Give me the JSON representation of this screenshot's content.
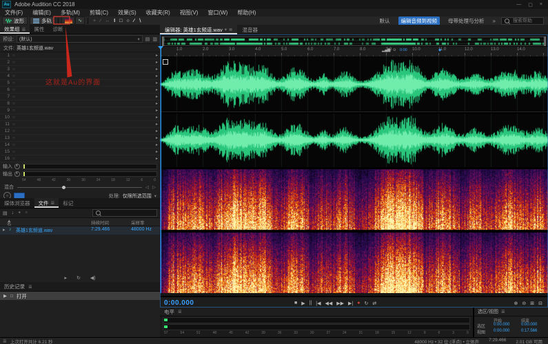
{
  "window": {
    "title": "Adobe Audition CC 2018",
    "app_badge": "Au",
    "minimize": "—",
    "maximize": "▢",
    "close": "×"
  },
  "menu": {
    "items": [
      "文件(F)",
      "编辑(E)",
      "多轨(M)",
      "剪辑(C)",
      "效果(S)",
      "收藏夹(R)",
      "视图(V)",
      "窗口(W)",
      "帮助(H)"
    ]
  },
  "toolbar": {
    "waveform_label": "波形",
    "multitrack_label": "多轨",
    "workspaces": [
      "默认",
      "编辑音频到视频",
      "母带处理与分析"
    ],
    "active_workspace": "编辑音频到视频",
    "overflow_glyph": "»",
    "search_placeholder": "搜索帮助"
  },
  "effects_rack": {
    "tabs": [
      "效果组",
      "属性",
      "诊断"
    ],
    "active_tab": "效果组",
    "preset_label": "预设:",
    "preset_value": "(默认)",
    "file_label": "文件:",
    "file_name": "英雄1玄频道.wav",
    "slot_numbers": [
      1,
      2,
      3,
      4,
      5,
      6,
      7,
      8,
      9,
      10,
      11,
      12,
      13,
      14,
      15,
      16
    ],
    "input_label": "输入",
    "output_label": "输出",
    "meter_scale": [
      54,
      48,
      42,
      36,
      30,
      24,
      18,
      12,
      6,
      0
    ],
    "mix_label": "混合",
    "process_label": "处理:",
    "process_value": "仅限所选范围"
  },
  "files_panel": {
    "tabs": [
      "媒体浏览器",
      "文件",
      "标记"
    ],
    "active_tab": "文件",
    "columns": [
      "名称",
      "持续时间",
      "采样率"
    ],
    "rows": [
      {
        "name": "英雄1玄频道.wav",
        "duration": "7:29.466",
        "sample_rate": "48000 Hz"
      }
    ]
  },
  "history_panel": {
    "title": "历史记录",
    "items": [
      {
        "label": "打开"
      }
    ]
  },
  "editor": {
    "tab_label": "编辑器: 英雄1玄频道.wav",
    "mixer_tab": "混音器",
    "ruler_ticks": [
      "1.0",
      "2.0",
      "3.0",
      "4.0",
      "5.0",
      "6.0",
      "7.0",
      "8.0",
      "9.0",
      "10.0",
      "11.0",
      "12.0",
      "13.0",
      "14.0"
    ],
    "hud_time": "0:00"
  },
  "annotation": {
    "text": "这就是Au的界面",
    "color": "#a8231a"
  },
  "transport": {
    "time": "0:00.000",
    "buttons": [
      {
        "name": "stop-button",
        "glyph": "■"
      },
      {
        "name": "play-button",
        "glyph": "▶"
      },
      {
        "name": "pause-button",
        "glyph": "||"
      },
      {
        "name": "skip-to-start-button",
        "glyph": "|◀"
      },
      {
        "name": "rewind-button",
        "glyph": "◀◀"
      },
      {
        "name": "fast-forward-button",
        "glyph": "▶▶"
      },
      {
        "name": "skip-to-end-button",
        "glyph": "▶|"
      },
      {
        "name": "record-button",
        "glyph": "●",
        "color": "#cf4237"
      },
      {
        "name": "loop-button",
        "glyph": "↻"
      },
      {
        "name": "shuttle-button",
        "glyph": "⇄"
      }
    ],
    "zoom_buttons": [
      {
        "name": "zoom-in-button",
        "glyph": "⊕"
      },
      {
        "name": "zoom-out-button",
        "glyph": "⊖"
      },
      {
        "name": "zoom-selection-button",
        "glyph": "⊞"
      },
      {
        "name": "zoom-full-button",
        "glyph": "⊟"
      }
    ]
  },
  "levels_panel": {
    "title": "电平",
    "scale": [
      57,
      54,
      51,
      48,
      45,
      42,
      39,
      36,
      33,
      30,
      27,
      24,
      21,
      18,
      15,
      12,
      9,
      6,
      3,
      0
    ]
  },
  "selection_panel": {
    "title": "选区/视图",
    "columns": [
      "开始",
      "结束"
    ],
    "rows": [
      {
        "label": "选区",
        "start": "0:00.000",
        "end": "0:00.000"
      },
      {
        "label": "视图",
        "start": "0:00.000",
        "end": "0:17.566"
      }
    ]
  },
  "status_bar": {
    "left_text": "上次打开共计 6.21 秒",
    "format_info": "48000 Hz • 32 位 (浮点) • 立体声",
    "duration": "7:29.466",
    "free_space": "2.01 GB 可用"
  },
  "colors": {
    "waveform_green": "#2bd183",
    "accent_blue": "#3aa0ff",
    "annotation_red": "#c9271c",
    "record_red": "#cf4237",
    "workspace_active_bg": "#2a6fc2"
  },
  "waveform": {
    "bursts": [
      {
        "c": 0.035,
        "w": 0.015,
        "a": 0.45
      },
      {
        "c": 0.09,
        "w": 0.03,
        "a": 0.62
      },
      {
        "c": 0.17,
        "w": 0.02,
        "a": 0.5
      },
      {
        "c": 0.215,
        "w": 0.035,
        "a": 0.78
      },
      {
        "c": 0.27,
        "w": 0.018,
        "a": 0.5
      },
      {
        "c": 0.35,
        "w": 0.025,
        "a": 0.68
      },
      {
        "c": 0.42,
        "w": 0.012,
        "a": 0.4
      },
      {
        "c": 0.475,
        "w": 0.02,
        "a": 0.52
      },
      {
        "c": 0.6,
        "w": 0.035,
        "a": 0.97
      },
      {
        "c": 0.655,
        "w": 0.018,
        "a": 0.6
      },
      {
        "c": 0.73,
        "w": 0.025,
        "a": 0.66
      },
      {
        "c": 0.81,
        "w": 0.02,
        "a": 0.46
      },
      {
        "c": 0.9,
        "w": 0.03,
        "a": 0.62
      },
      {
        "c": 0.975,
        "w": 0.02,
        "a": 0.5
      }
    ]
  }
}
